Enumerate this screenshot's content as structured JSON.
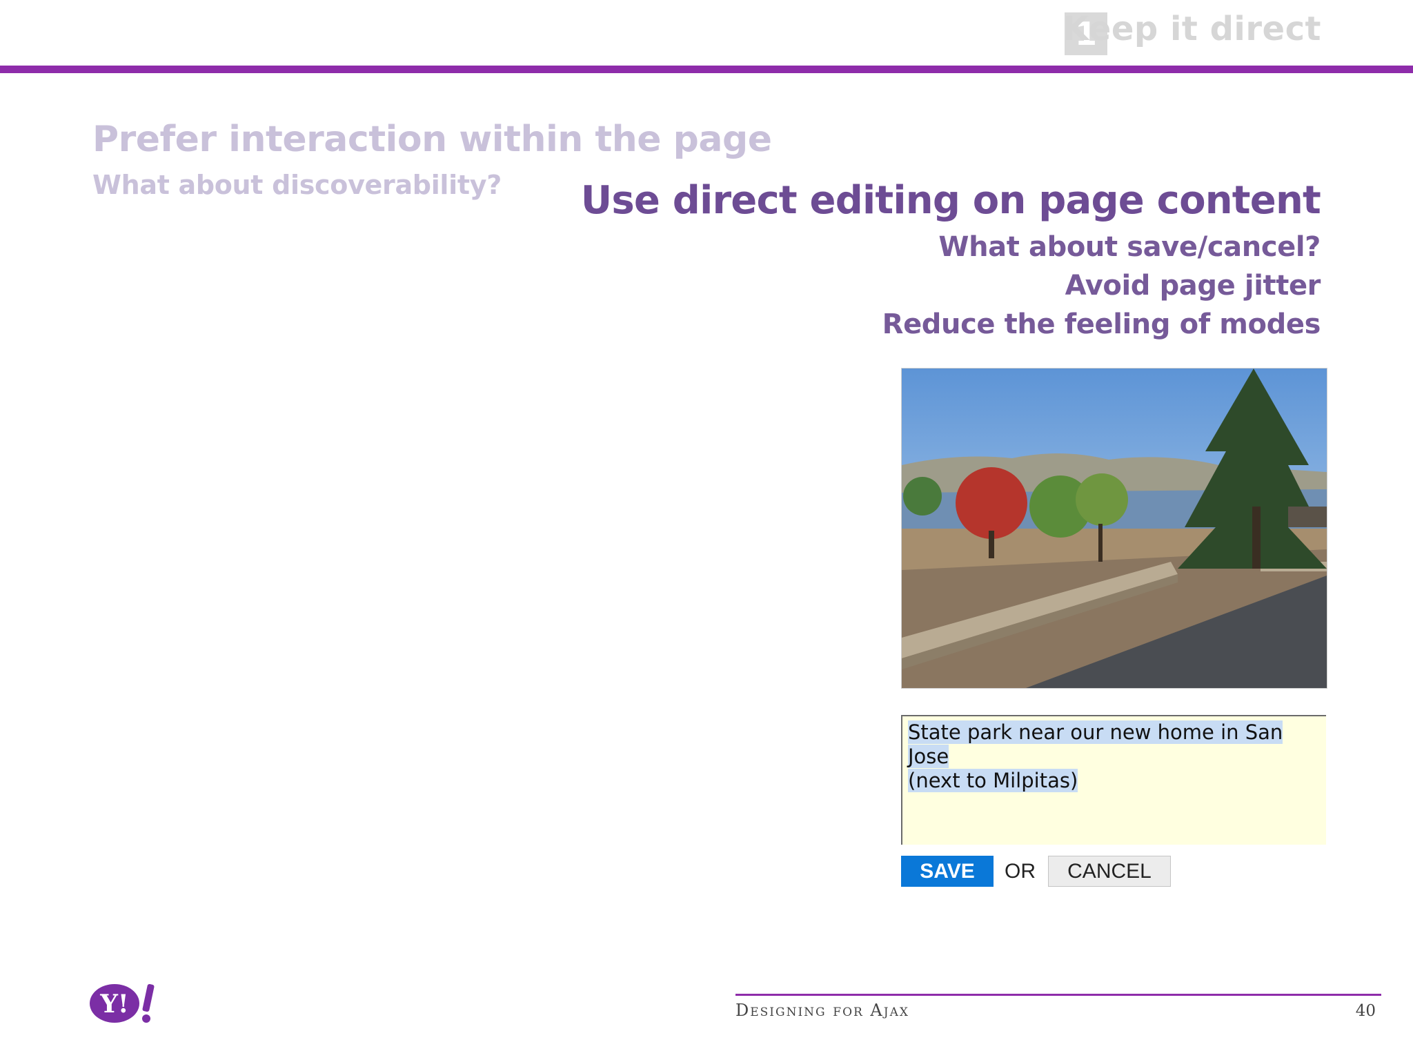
{
  "header": {
    "section_number": "1",
    "section_title": "Keep it direct"
  },
  "faded": {
    "title": "Prefer interaction within the page",
    "subtitle": "What about discoverability?"
  },
  "main": {
    "heading": "Use direct editing on page content",
    "points": [
      "What about save/cancel?",
      "Avoid page jitter",
      "Reduce the feeling of modes"
    ]
  },
  "editor": {
    "line1": "State park near our new home in San Jose",
    "line2": "(next to Milpitas)",
    "save_label": "SAVE",
    "or_label": "OR",
    "cancel_label": "CANCEL"
  },
  "footer": {
    "title": "Designing for Ajax",
    "page_number": "40",
    "logo_text": "Y!"
  },
  "colors": {
    "accent_bar": "#8e2caa",
    "heading": "#6d4c94",
    "faded": "#c9c1da",
    "save_button": "#0a78d8",
    "editor_bg": "#ffffe0"
  },
  "icons": {
    "logo": "yahoo-logo-icon",
    "photo": "park-photo"
  }
}
